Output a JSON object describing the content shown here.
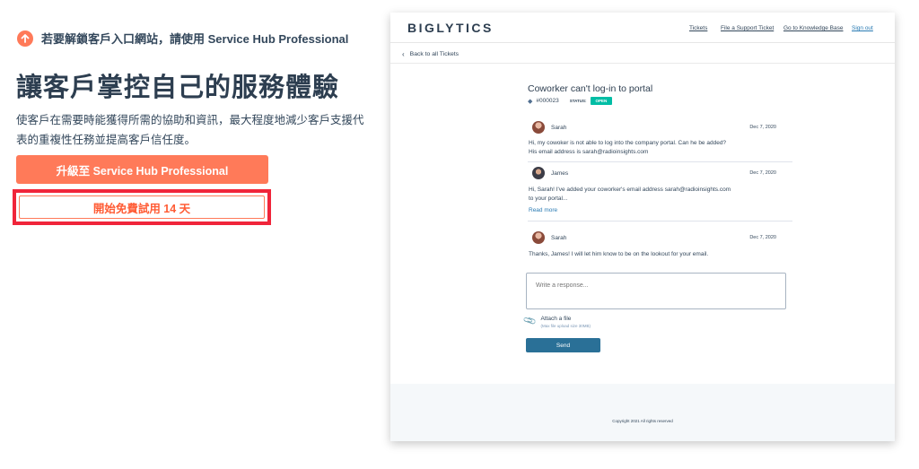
{
  "left": {
    "notice": "若要解鎖客戶入口網站，請使用 Service Hub Professional",
    "headline": "讓客戶掌控自己的服務體驗",
    "description": "使客戶在需要時能獲得所需的協助和資訊，最大程度地減少客戶支援代表的重複性任務並提高客戶信任度。",
    "upgrade_button": "升級至 Service Hub Professional",
    "trial_button": "開始免費試用 14 天",
    "icon": "arrow-up-circle-icon",
    "colors": {
      "accent": "#ff7a59",
      "highlight": "#f0253a",
      "text": "#33475b"
    }
  },
  "portal": {
    "logo": "BIGLYTICS",
    "nav": [
      "Tickets",
      "File a Support Ticket",
      "Go to Knowledge Base",
      "Sign out"
    ],
    "back_link": "Back to all Tickets",
    "ticket": {
      "title": "Coworker can't log-in to portal",
      "id": "#000023",
      "status_label": "STATUS:",
      "status": "OPEN"
    },
    "messages": [
      {
        "name": "Sarah",
        "date": "Dec 7, 2020",
        "lines": [
          "Hi,  my cowoker is not able to log into the company portal. Can he be added?",
          "His email address is sarah@radioinsights.com"
        ]
      },
      {
        "name": "James",
        "date": "Dec 7, 2020",
        "lines": [
          "Hi, Sarah! I've added your coworker's email address sarah@radioinsights.com",
          "to your portal..."
        ],
        "read_more": "Read more"
      },
      {
        "name": "Sarah",
        "date": "Dec 7, 2020",
        "lines": [
          "Thanks, James! I will let him know to be on the lookout for your email."
        ]
      }
    ],
    "response_placeholder": "Write a response...",
    "attach_label": "Attach a file",
    "attach_note": "(Max file upload size 30MB)",
    "send_button": "Send",
    "copyright": "Copyright 2021 All rights reserved",
    "colors": {
      "status": "#00bda5",
      "send": "#2a7097",
      "link": "#2a7bb3"
    }
  }
}
